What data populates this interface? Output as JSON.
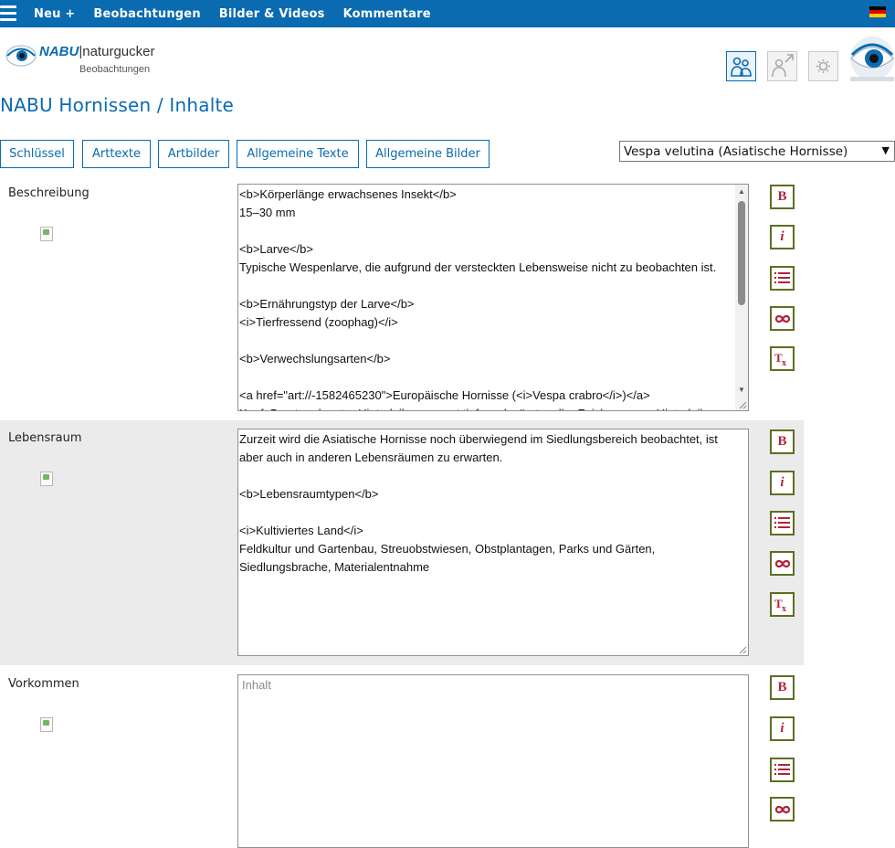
{
  "topnav": {
    "items": [
      "Neu +",
      "Beobachtungen",
      "Bilder & Videos",
      "Kommentare"
    ]
  },
  "header": {
    "logo_nabu": "NABU",
    "logo_separator": "|",
    "logo_naturgucker": "naturgucker",
    "logo_sub": "Beobachtungen",
    "icons": [
      "people-icon",
      "export-person-icon",
      "gear-icon",
      "naturgucker-eye-logo"
    ]
  },
  "page": {
    "title": "NABU Hornissen / Inhalte"
  },
  "tabs": [
    "Schlüssel",
    "Arttexte",
    "Artbilder",
    "Allgemeine Texte",
    "Allgemeine Bilder"
  ],
  "species_select": {
    "value": "Vespa velutina (Asiatische Hornisse)"
  },
  "sections": [
    {
      "label": "Beschreibung",
      "text": "<b>Körperlänge erwachsenes Insekt</b>\n15–30 mm\n\n<b>Larve</b>\nTypische Wespenlarve, die aufgrund der versteckten Lebensweise nicht zu beobachten ist.\n\n<b>Ernährungstyp der Larve</b>\n<i>Tierfressend (zoophag)</i>\n\n<b>Verwechslungsarten</b>\n\n<a href=\"art://-1582465230\">Europäische Hornisse (<i>Vespa crabro</i>)</a>\nKopf, Brust und erster Hinterleibssegment tiefgeschwärzt, gelbe Zeichnung am Hinterleib"
    },
    {
      "label": "Lebensraum",
      "text": "Zurzeit wird die Asiatische Hornisse noch überwiegend im Siedlungsbereich beobachtet, ist aber auch in anderen Lebensräumen zu erwarten.\n\n<b>Lebensraumtypen</b>\n\n<i>Kultiviertes Land</i>\nFeldkultur und Gartenbau, Streuobstwiesen, Obstplantagen, Parks und Gärten, Siedlungsbrache, Materialentnahme"
    },
    {
      "label": "Vorkommen",
      "text": "",
      "placeholder": "Inhalt"
    }
  ],
  "toolbar": {
    "bold": "B",
    "italic": "i",
    "list": "list-icon",
    "link": "link-icon",
    "clear": "clear-format-icon"
  },
  "colors": {
    "topbar": "#0a6bb1",
    "accent": "#0a6bb1",
    "tool_border": "#5f6e22",
    "tool_glyph": "#b0243a",
    "section_alt_bg": "#ebebeb"
  }
}
